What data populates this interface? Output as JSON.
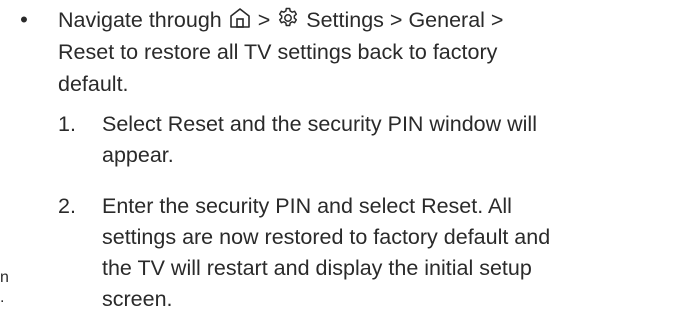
{
  "bullet": {
    "marker": "•",
    "prefix": "Navigate through",
    "home_icon": "home-icon",
    "sep1": ">",
    "gear_icon": "gear-icon",
    "path": "Settings > General >",
    "rest_line2": "Reset to restore all TV settings back to factory",
    "rest_line3": "default."
  },
  "steps": [
    {
      "marker": "1.",
      "line1": "Select Reset and the security PIN window will",
      "line2": "appear."
    },
    {
      "marker": "2.",
      "line1": "Enter the security PIN and select Reset. All",
      "line2": "settings are now restored to factory default and",
      "line3": "the TV will restart and display the initial setup",
      "line4": "screen."
    }
  ],
  "edge_fragment": {
    "line1": "n",
    "line2": "."
  }
}
